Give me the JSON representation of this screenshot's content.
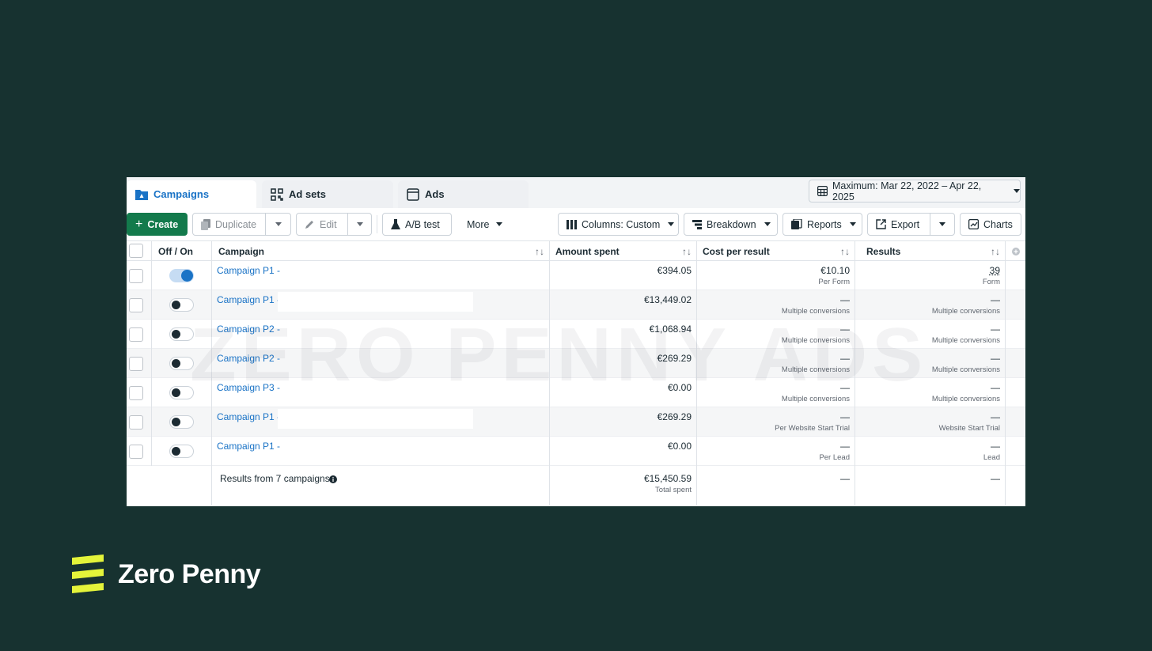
{
  "tabs": [
    {
      "label": "Campaigns",
      "icon": "folder-icon",
      "active": true
    },
    {
      "label": "Ad sets",
      "icon": "grid-icon",
      "active": false
    },
    {
      "label": "Ads",
      "icon": "window-icon",
      "active": false
    }
  ],
  "date_range": {
    "label": "Maximum: Mar 22, 2022 – Apr 22, 2025"
  },
  "toolbar": {
    "create": "Create",
    "duplicate": "Duplicate",
    "edit": "Edit",
    "ab_test": "A/B test",
    "more": "More",
    "columns": "Columns: Custom",
    "breakdown": "Breakdown",
    "reports": "Reports",
    "export": "Export",
    "charts": "Charts"
  },
  "columns": {
    "offon": "Off / On",
    "campaign": "Campaign",
    "amount": "Amount spent",
    "cost": "Cost per result",
    "results": "Results"
  },
  "rows": [
    {
      "name": "Campaign P1 -",
      "on": true,
      "amount": "€394.05",
      "cost": "€10.10",
      "cost_sub": "Per Form",
      "results": "39",
      "results_sub": "Form"
    },
    {
      "name": "Campaign P1 -",
      "on": false,
      "amount": "€13,449.02",
      "cost": "—",
      "cost_sub": "Multiple conversions",
      "results": "—",
      "results_sub": "Multiple conversions"
    },
    {
      "name": "Campaign P2 -",
      "on": false,
      "amount": "€1,068.94",
      "cost": "—",
      "cost_sub": "Multiple conversions",
      "results": "—",
      "results_sub": "Multiple conversions"
    },
    {
      "name": "Campaign P2 -",
      "on": false,
      "amount": "€269.29",
      "cost": "—",
      "cost_sub": "Multiple conversions",
      "results": "—",
      "results_sub": "Multiple conversions"
    },
    {
      "name": "Campaign P3 -",
      "on": false,
      "amount": "€0.00",
      "cost": "—",
      "cost_sub": "Multiple conversions",
      "results": "—",
      "results_sub": "Multiple conversions"
    },
    {
      "name": "Campaign P1 -",
      "on": false,
      "amount": "€269.29",
      "cost": "—",
      "cost_sub": "Per Website Start Trial",
      "results": "—",
      "results_sub": "Website Start Trial"
    },
    {
      "name": "Campaign P1 -",
      "on": false,
      "amount": "€0.00",
      "cost": "—",
      "cost_sub": "Per Lead",
      "results": "—",
      "results_sub": "Lead"
    }
  ],
  "footer": {
    "label": "Results from 7 campaigns",
    "amount": "€15,450.59",
    "amount_sub": "Total spent",
    "cost": "—",
    "results": "—"
  },
  "watermark": "ZERO PENNY ADS",
  "brand": {
    "name": "Zero Penny",
    "accent": "#e4f43a",
    "background": "#173230"
  },
  "colors": {
    "link": "#1a73c6",
    "create": "#137a4c"
  }
}
